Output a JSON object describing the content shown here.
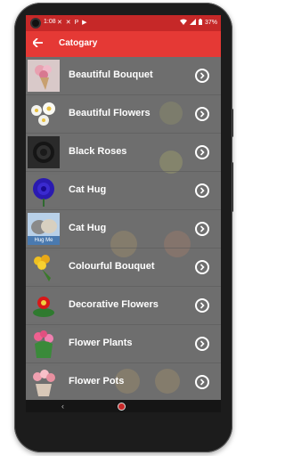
{
  "statusbar": {
    "time": "1:08",
    "left_icons": "✕ ✕ P ▶",
    "battery_pct": "37%"
  },
  "appbar": {
    "title": "Catogary"
  },
  "categories": [
    {
      "label": "Beautiful Bouquet",
      "thumb": "pink-bouquet"
    },
    {
      "label": "Beautiful Flowers",
      "thumb": "white-flowers"
    },
    {
      "label": "Black Roses",
      "thumb": "black-rose"
    },
    {
      "label": "Cat Hug",
      "thumb": "blue-rose"
    },
    {
      "label": "Cat Hug",
      "thumb": "hug-me-cat"
    },
    {
      "label": "Colourful Bouquet",
      "thumb": "yellow-bouquet"
    },
    {
      "label": "Decorative Flowers",
      "thumb": "red-flowers"
    },
    {
      "label": "Flower Plants",
      "thumb": "flower-plant"
    },
    {
      "label": "Flower Pots",
      "thumb": "flower-pot"
    }
  ],
  "thumb_texts": {
    "hug_me": "Hug Me"
  },
  "colors": {
    "statusbar": "#c62828",
    "appbar": "#e53935",
    "list_bg": "#6e6e6e",
    "text": "#ffffff"
  }
}
